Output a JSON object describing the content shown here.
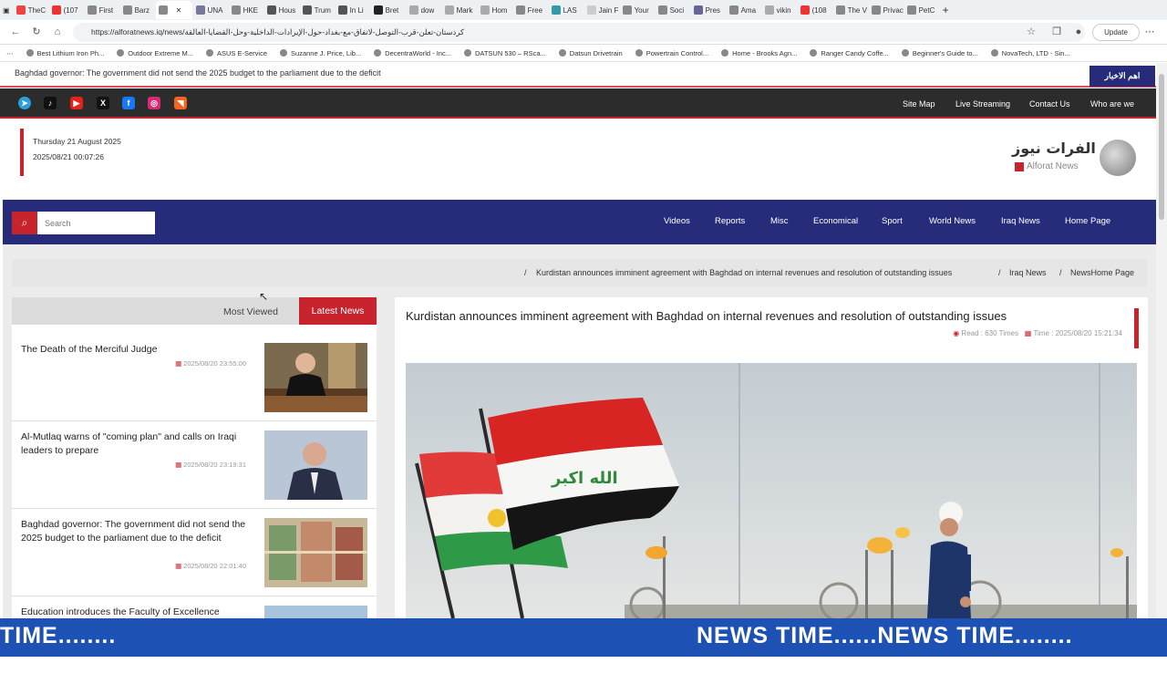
{
  "browser": {
    "tabs": [
      "TheC",
      "(107",
      "First",
      "Barz",
      "",
      "UNA",
      "HKE",
      "Hous",
      "Trum",
      "In Li",
      "Bret",
      "dow",
      "Mark",
      "Hom",
      "Free",
      "LAS",
      "Jain F",
      "Your",
      "Soci",
      "Pres",
      "Ama",
      "vikin",
      "(108",
      "The V",
      "Privacy ar",
      "PetC"
    ],
    "tab_colors": [
      "#e44",
      "#e33",
      "#888",
      "#888",
      "#888",
      "#779",
      "#888",
      "#555",
      "#555",
      "#555",
      "#222",
      "#aaa",
      "#aaa",
      "#aaa",
      "#888",
      "#39a",
      "#ccc",
      "#888",
      "#888",
      "#669",
      "#888",
      "#aaa",
      "#e33",
      "#888",
      "#888",
      "#888"
    ],
    "url": "https://alforatnews.iq/news/كردستان-تعلن-قرب-التوصل-لاتفاق-مع-بغداد-حول-الإيرادات-الداخلية-وحل-القضايا-العالقة",
    "update_label": "Update",
    "bookmarks": [
      "Best Lithium Iron Ph...",
      "Outdoor Extreme M...",
      "ASUS E-Service",
      "Suzanne J. Price, Lib...",
      "DecentraWorld - Inc...",
      "DATSUN 530 – RSca...",
      "Datsun Drivetrain",
      "Powertrain Control...",
      "Home - Brooks Agn...",
      "Ranger Candy Coffe...",
      "Beginner's Guide to...",
      "NovaTech, LTD - Sin..."
    ]
  },
  "site": {
    "ticker_text": "Baghdad governor: The government did not send the 2025 budget to the parliament due to the deficit",
    "ticker_label": "اهم الاخبار",
    "top_links": [
      "Site Map",
      "Live Streaming",
      "Contact Us",
      "Who are we"
    ],
    "date_line": "Thursday 21 August 2025",
    "datetime_line": "2025/08/21 00:07:26",
    "logo_arabic": "الفرات نيوز",
    "logo_english": "Alforat News",
    "search_placeholder": "Search",
    "nav": [
      "Videos",
      "Reports",
      "Misc",
      "Economical",
      "Sport",
      "World News",
      "Iraq News",
      "Home Page"
    ],
    "breadcrumb": {
      "article": "Kurdistan announces imminent agreement with Baghdad on internal revenues and resolution of outstanding issues",
      "section": "Iraq News",
      "home": "NewsHome Page"
    },
    "tabs": {
      "most_viewed": "Most Viewed",
      "latest": "Latest News"
    },
    "news_items": [
      {
        "title": "The Death of the Merciful Judge",
        "time": "2025/08/20 23:55:00"
      },
      {
        "title": "Al-Mutlaq warns of \"coming plan\" and calls on Iraqi leaders to prepare",
        "time": "2025/08/20 23:19:31"
      },
      {
        "title": "Baghdad governor: The government did not send the 2025 budget to the parliament due to the deficit",
        "time": "2025/08/20 22:01:40"
      },
      {
        "title": "Education introduces the Faculty of Excellence",
        "time": ""
      }
    ],
    "article": {
      "title": "Kurdistan announces imminent agreement with Baghdad on internal revenues and resolution of outstanding issues",
      "read": "Read : 630 Times",
      "time": "Time : 2025/08/20 15:21:34"
    }
  },
  "overlay": {
    "marquee_left": "TIME........",
    "marquee_right": "NEWS TIME......NEWS TIME........"
  },
  "colors": {
    "navy": "#262c79",
    "red": "#c8242e",
    "ticker_blue": "#1d51b3"
  }
}
